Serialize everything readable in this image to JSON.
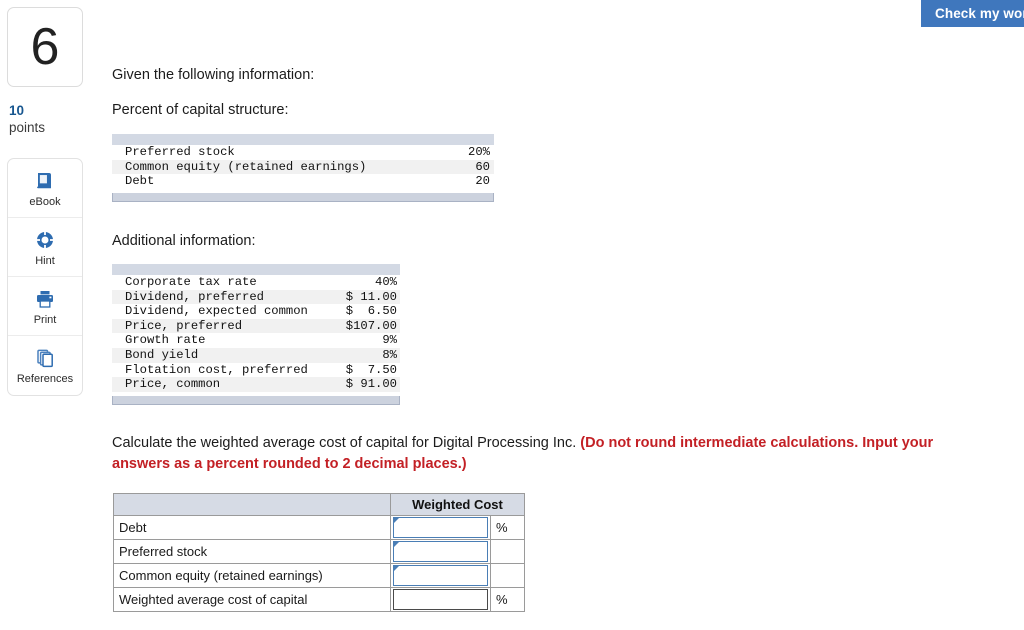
{
  "toolbar": {
    "check_work_label": "Check my work"
  },
  "sidebar": {
    "question_number": "6",
    "points_value": "10",
    "points_label": "points",
    "tools": [
      {
        "label": "eBook",
        "icon": "ebook-icon"
      },
      {
        "label": "Hint",
        "icon": "lifebuoy-icon"
      },
      {
        "label": "Print",
        "icon": "printer-icon"
      },
      {
        "label": "References",
        "icon": "copy-pages-icon"
      }
    ]
  },
  "content": {
    "given_line": "Given the following information:",
    "percent_line": "Percent of capital structure:",
    "additional_line": "Additional information:",
    "question_text": "Calculate the weighted average cost of capital for Digital Processing Inc. ",
    "question_emphasis": "(Do not round intermediate calculations. Input your answers as a percent rounded to 2 decimal places.)"
  },
  "capital_structure_table": {
    "rows": [
      {
        "label": "Preferred stock",
        "value": "20%"
      },
      {
        "label": "Common equity (retained earnings)",
        "value": "60"
      },
      {
        "label": "Debt",
        "value": "20"
      }
    ]
  },
  "additional_info_table": {
    "rows": [
      {
        "label": "Corporate tax rate",
        "value": "40%"
      },
      {
        "label": "Dividend, preferred",
        "value": "$ 11.00"
      },
      {
        "label": "Dividend, expected common",
        "value": "$  6.50"
      },
      {
        "label": "Price, preferred",
        "value": "$107.00"
      },
      {
        "label": "Growth rate",
        "value": "9%"
      },
      {
        "label": "Bond yield",
        "value": "8%"
      },
      {
        "label": "Flotation cost, preferred",
        "value": "$  7.50"
      },
      {
        "label": "Price, common",
        "value": "$ 91.00"
      }
    ]
  },
  "answer_table": {
    "header_blank": "",
    "header_weighted_cost": "Weighted Cost",
    "rows": [
      {
        "label": "Debt",
        "value": "",
        "unit": "%",
        "flagged": true
      },
      {
        "label": "Preferred stock",
        "value": "",
        "unit": "",
        "flagged": true
      },
      {
        "label": "Common equity (retained earnings)",
        "value": "",
        "unit": "",
        "flagged": true
      },
      {
        "label": "Weighted average cost of capital",
        "value": "",
        "unit": "%",
        "flagged": false
      }
    ]
  },
  "colors": {
    "accent_blue": "#3f77bd",
    "points_blue": "#17568f",
    "emphasis_red": "#c32025",
    "table_header_bar": "#d3d9e4",
    "input_border_blue": "#4a7eb5"
  }
}
